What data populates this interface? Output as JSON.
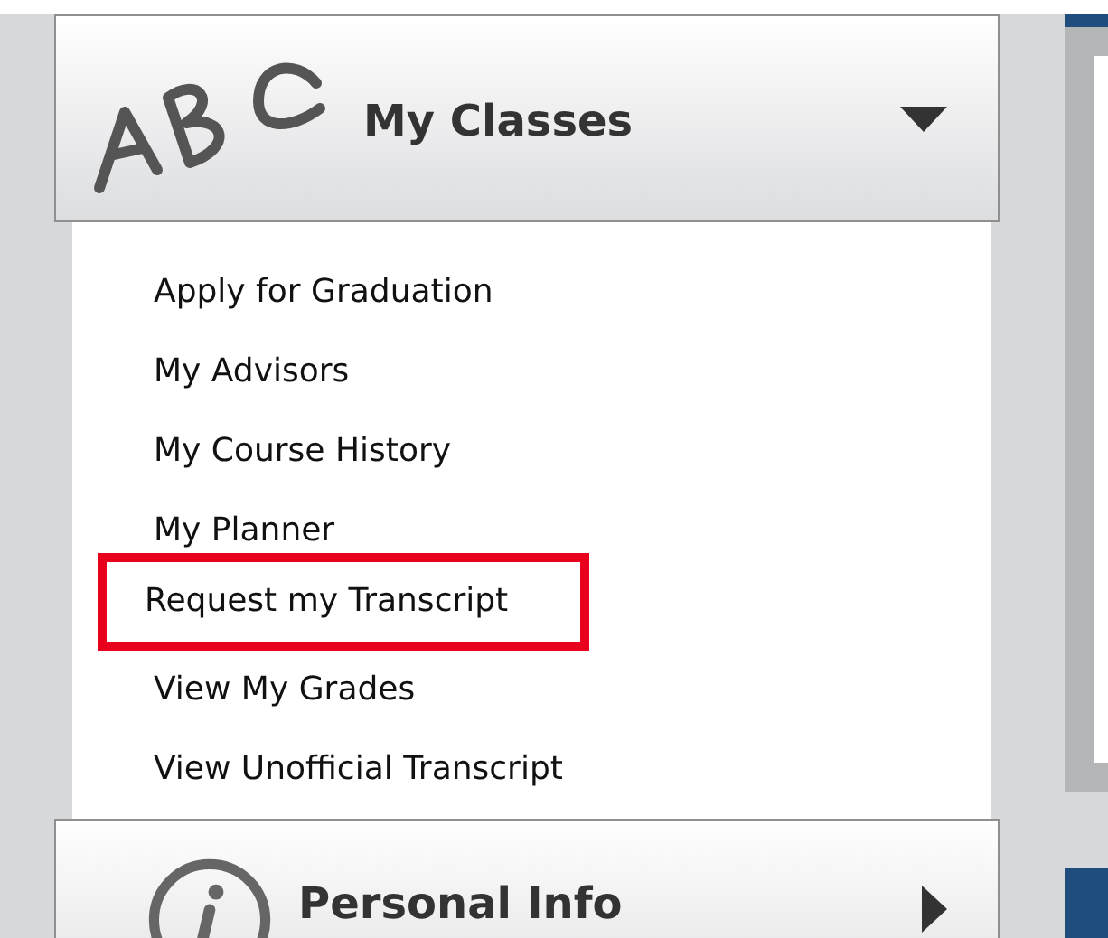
{
  "sections": [
    {
      "title": "My Classes",
      "kind": "abc",
      "expanded": true,
      "links": [
        {
          "label": "Apply for Graduation",
          "selected": false
        },
        {
          "label": "My Advisors",
          "selected": false
        },
        {
          "label": "My Course History",
          "selected": false
        },
        {
          "label": "My Planner",
          "selected": false
        },
        {
          "label": "Request my Transcript",
          "selected": true
        },
        {
          "label": "View My Grades",
          "selected": false
        },
        {
          "label": "View Unofficial Transcript",
          "selected": false
        }
      ]
    },
    {
      "title": "Personal Info",
      "kind": "info",
      "expanded": false
    }
  ]
}
